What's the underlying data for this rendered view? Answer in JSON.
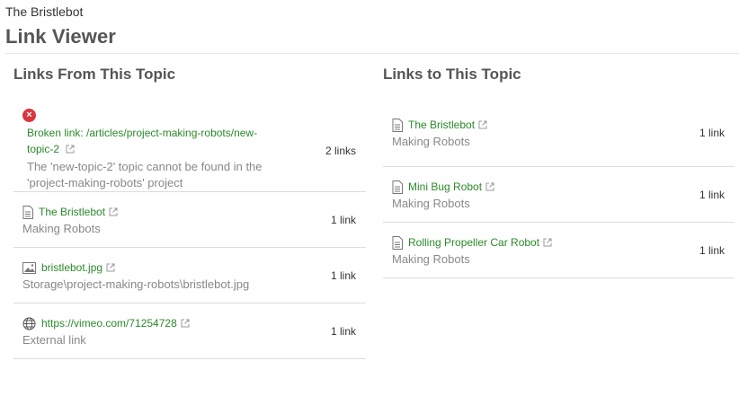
{
  "header": {
    "subtitle": "The Bristlebot",
    "title": "Link Viewer"
  },
  "from_topic": {
    "title": "Links From This Topic",
    "items": [
      {
        "icon": "error-icon",
        "link_line1": "Broken link: /articles/project-making-robots/new-",
        "link_line2": "topic-2",
        "description_line1": "The 'new-topic-2' topic cannot be found in the",
        "description_line2": "'project-making-robots' project",
        "count": "2 links"
      },
      {
        "icon": "document-icon",
        "link": "The Bristlebot",
        "description": "Making Robots",
        "count": "1 link"
      },
      {
        "icon": "image-icon",
        "link": "bristlebot.jpg",
        "description": "Storage\\project-making-robots\\bristlebot.jpg",
        "count": "1 link"
      },
      {
        "icon": "globe-icon",
        "link": "https://vimeo.com/71254728",
        "description": "External link",
        "count": "1 link"
      }
    ]
  },
  "to_topic": {
    "title": "Links to This Topic",
    "items": [
      {
        "icon": "document-icon",
        "link": "The Bristlebot",
        "description": "Making Robots",
        "count": "1 link"
      },
      {
        "icon": "document-icon",
        "link": "Mini Bug Robot",
        "description": "Making Robots",
        "count": "1 link"
      },
      {
        "icon": "document-icon",
        "link": "Rolling Propeller Car Robot",
        "description": "Making Robots",
        "count": "1 link"
      }
    ]
  },
  "colors": {
    "link": "#2a8a2a",
    "error": "#d9363e",
    "muted": "#888888",
    "divider": "#dcdcdc"
  }
}
